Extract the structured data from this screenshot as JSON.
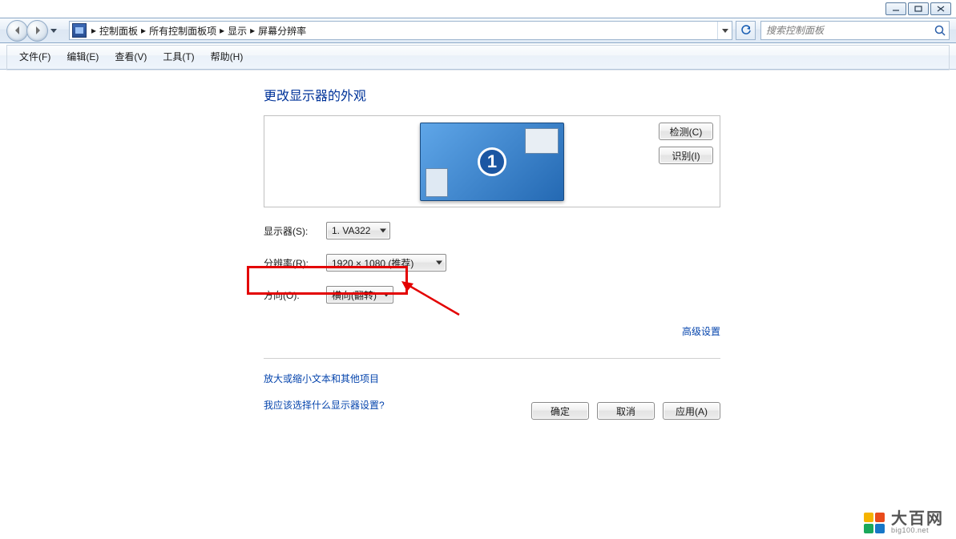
{
  "window_controls": {
    "min": "min",
    "max": "max",
    "close": "close"
  },
  "breadcrumbs": {
    "root": "控制面板",
    "all": "所有控制面板项",
    "display": "显示",
    "leaf": "屏幕分辨率"
  },
  "search": {
    "placeholder": "搜索控制面板"
  },
  "menu": {
    "file": "文件(F)",
    "edit": "编辑(E)",
    "view": "查看(V)",
    "tools": "工具(T)",
    "help": "帮助(H)"
  },
  "page_title": "更改显示器的外观",
  "monitor_number": "1",
  "side": {
    "detect": "检测(C)",
    "identify": "识别(I)"
  },
  "form": {
    "display_label": "显示器(S):",
    "display_value": "1. VA322",
    "resolution_label": "分辨率(R):",
    "resolution_value": "1920 × 1080 (推荐)",
    "orientation_label": "方向(O):",
    "orientation_value": "横向(翻转)"
  },
  "advanced": "高级设置",
  "help1": "放大或缩小文本和其他项目",
  "help2": "我应该选择什么显示器设置?",
  "actions": {
    "ok": "确定",
    "cancel": "取消",
    "apply": "应用(A)"
  },
  "watermark": {
    "cn": "大百网",
    "en": "big100.net"
  }
}
